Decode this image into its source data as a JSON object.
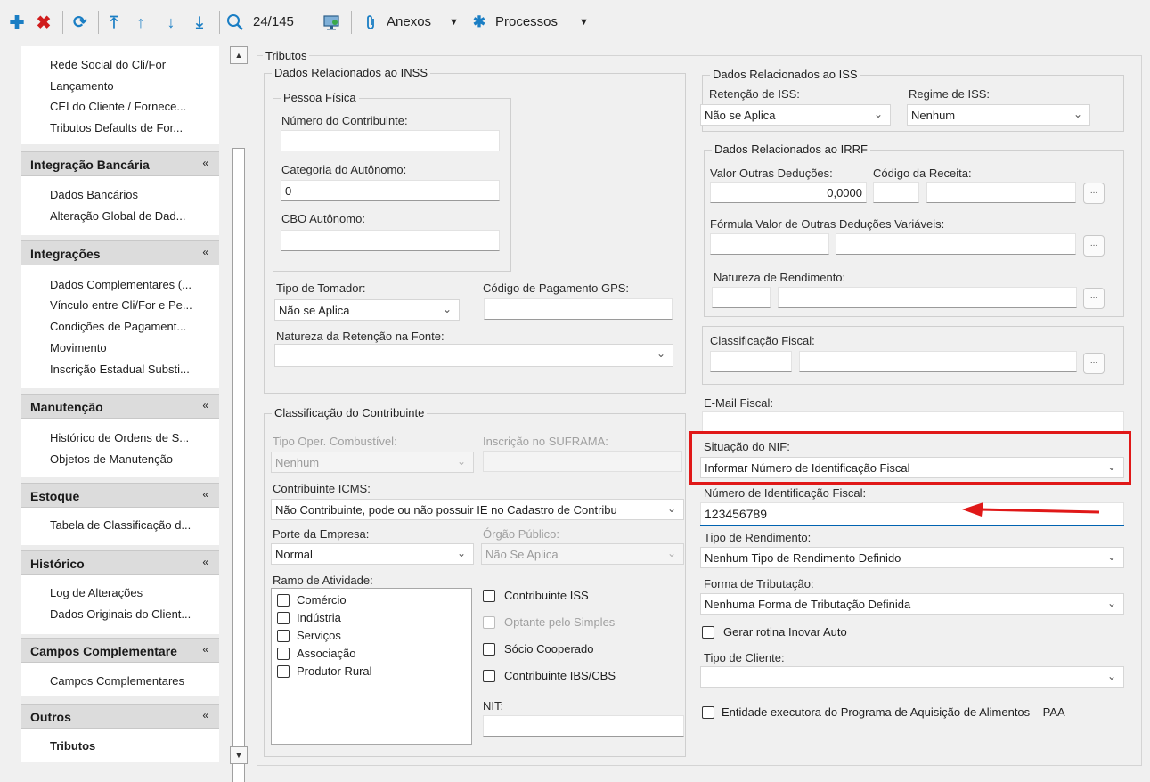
{
  "toolbar": {
    "add_icon": "plus-icon",
    "delete_icon": "x-icon",
    "record_counter": "24/145",
    "attachments_label": "Anexos",
    "processes_label": "Processos",
    "colors": {
      "add": "#1a7ec4",
      "delete": "#d01c1c"
    }
  },
  "nav": {
    "top_items": [
      "Rede Social do Cli/For",
      "Lançamento",
      "CEI do Cliente / Fornece...",
      "Tributos Defaults de For..."
    ],
    "sections": [
      {
        "title": "Integração Bancária",
        "items": [
          "Dados Bancários",
          "Alteração Global de Dad..."
        ]
      },
      {
        "title": "Integrações",
        "items": [
          "Dados Complementares (...",
          "Vínculo entre Cli/For e Pe...",
          "Condições de Pagament...",
          "Movimento",
          "Inscrição Estadual Substi..."
        ]
      },
      {
        "title": "Manutenção",
        "items": [
          "Histórico de Ordens de S...",
          "Objetos de Manutenção"
        ]
      },
      {
        "title": "Estoque",
        "items": [
          "Tabela de Classificação d..."
        ]
      },
      {
        "title": "Histórico",
        "items": [
          "Log de Alterações",
          "Dados Originais do Client..."
        ]
      },
      {
        "title": "Campos Complementare",
        "items": [
          "Campos Complementares"
        ]
      },
      {
        "title": "Outros",
        "items": [
          "Tributos"
        ]
      }
    ]
  },
  "form": {
    "tributos_title": "Tributos",
    "inss": {
      "title": "Dados Relacionados ao INSS",
      "pessoa_fisica": "Pessoa Física",
      "numero_contribuinte_label": "Número do Contribuinte:",
      "numero_contribuinte_value": "",
      "categoria_autonomo_label": "Categoria do Autônomo:",
      "categoria_autonomo_value": "0",
      "cbo_label": "CBO Autônomo:",
      "cbo_value": "",
      "tipo_tomador_label": "Tipo de Tomador:",
      "tipo_tomador_value": "Não se Aplica",
      "codigo_gps_label": "Código de Pagamento GPS:",
      "codigo_gps_value": "",
      "natureza_retencao_label": "Natureza da Retenção na Fonte:",
      "natureza_retencao_value": ""
    },
    "contribuinte": {
      "title": "Classificação do Contribuinte",
      "tipo_oper_label": "Tipo Oper. Combustível:",
      "tipo_oper_value": "Nenhum",
      "suframa_label": "Inscrição no SUFRAMA:",
      "suframa_value": "",
      "icms_label": "Contribuinte ICMS:",
      "icms_value": "Não Contribuinte, pode ou não possuir IE no Cadastro de Contribu",
      "porte_label": "Porte da Empresa:",
      "porte_value": "Normal",
      "orgao_label": "Órgão Público:",
      "orgao_value": "Não Se Aplica",
      "ramo_label": "Ramo de Atividade:",
      "ramo_items": [
        "Comércio",
        "Indústria",
        "Serviços",
        "Associação",
        "Produtor Rural"
      ],
      "chk_iss": "Contribuinte ISS",
      "chk_simples": "Optante pelo Simples",
      "chk_socio": "Sócio Cooperado",
      "chk_ibs": "Contribuinte IBS/CBS",
      "nit_label": "NIT:",
      "nit_value": ""
    },
    "iss": {
      "title": "Dados Relacionados ao ISS",
      "retencao_label": "Retenção de ISS:",
      "retencao_value": "Não se Aplica",
      "regime_label": "Regime de ISS:",
      "regime_value": "Nenhum"
    },
    "irrf": {
      "title": "Dados Relacionados ao IRRF",
      "valor_label": "Valor Outras Deduções:",
      "valor_value": "0,0000",
      "codigo_receita_label": "Código da Receita:",
      "formula_label": "Fórmula Valor de Outras Deduções Variáveis:",
      "natureza_label": "Natureza de Rendimento:"
    },
    "classificacao_fiscal_label": "Classificação Fiscal:",
    "email_fiscal_label": "E-Mail Fiscal:",
    "email_fiscal_value": "",
    "situacao_nif_label": "Situação do NIF:",
    "situacao_nif_value": "Informar Número de Identificação Fiscal",
    "numero_nif_label": "Número de Identificação Fiscal:",
    "numero_nif_value": "123456789",
    "tipo_rendimento_label": "Tipo de Rendimento:",
    "tipo_rendimento_value": "Nenhum Tipo de Rendimento Definido",
    "forma_tributacao_label": "Forma de Tributação:",
    "forma_tributacao_value": "Nenhuma Forma de Tributação Definida",
    "chk_inovar": "Gerar rotina Inovar Auto",
    "tipo_cliente_label": "Tipo de Cliente:",
    "tipo_cliente_value": "",
    "chk_paa": "Entidade executora do Programa de Aquisição de Alimentos – PAA"
  },
  "annotation": {
    "highlight_color": "#e01818",
    "arrow_color": "#e01818"
  }
}
